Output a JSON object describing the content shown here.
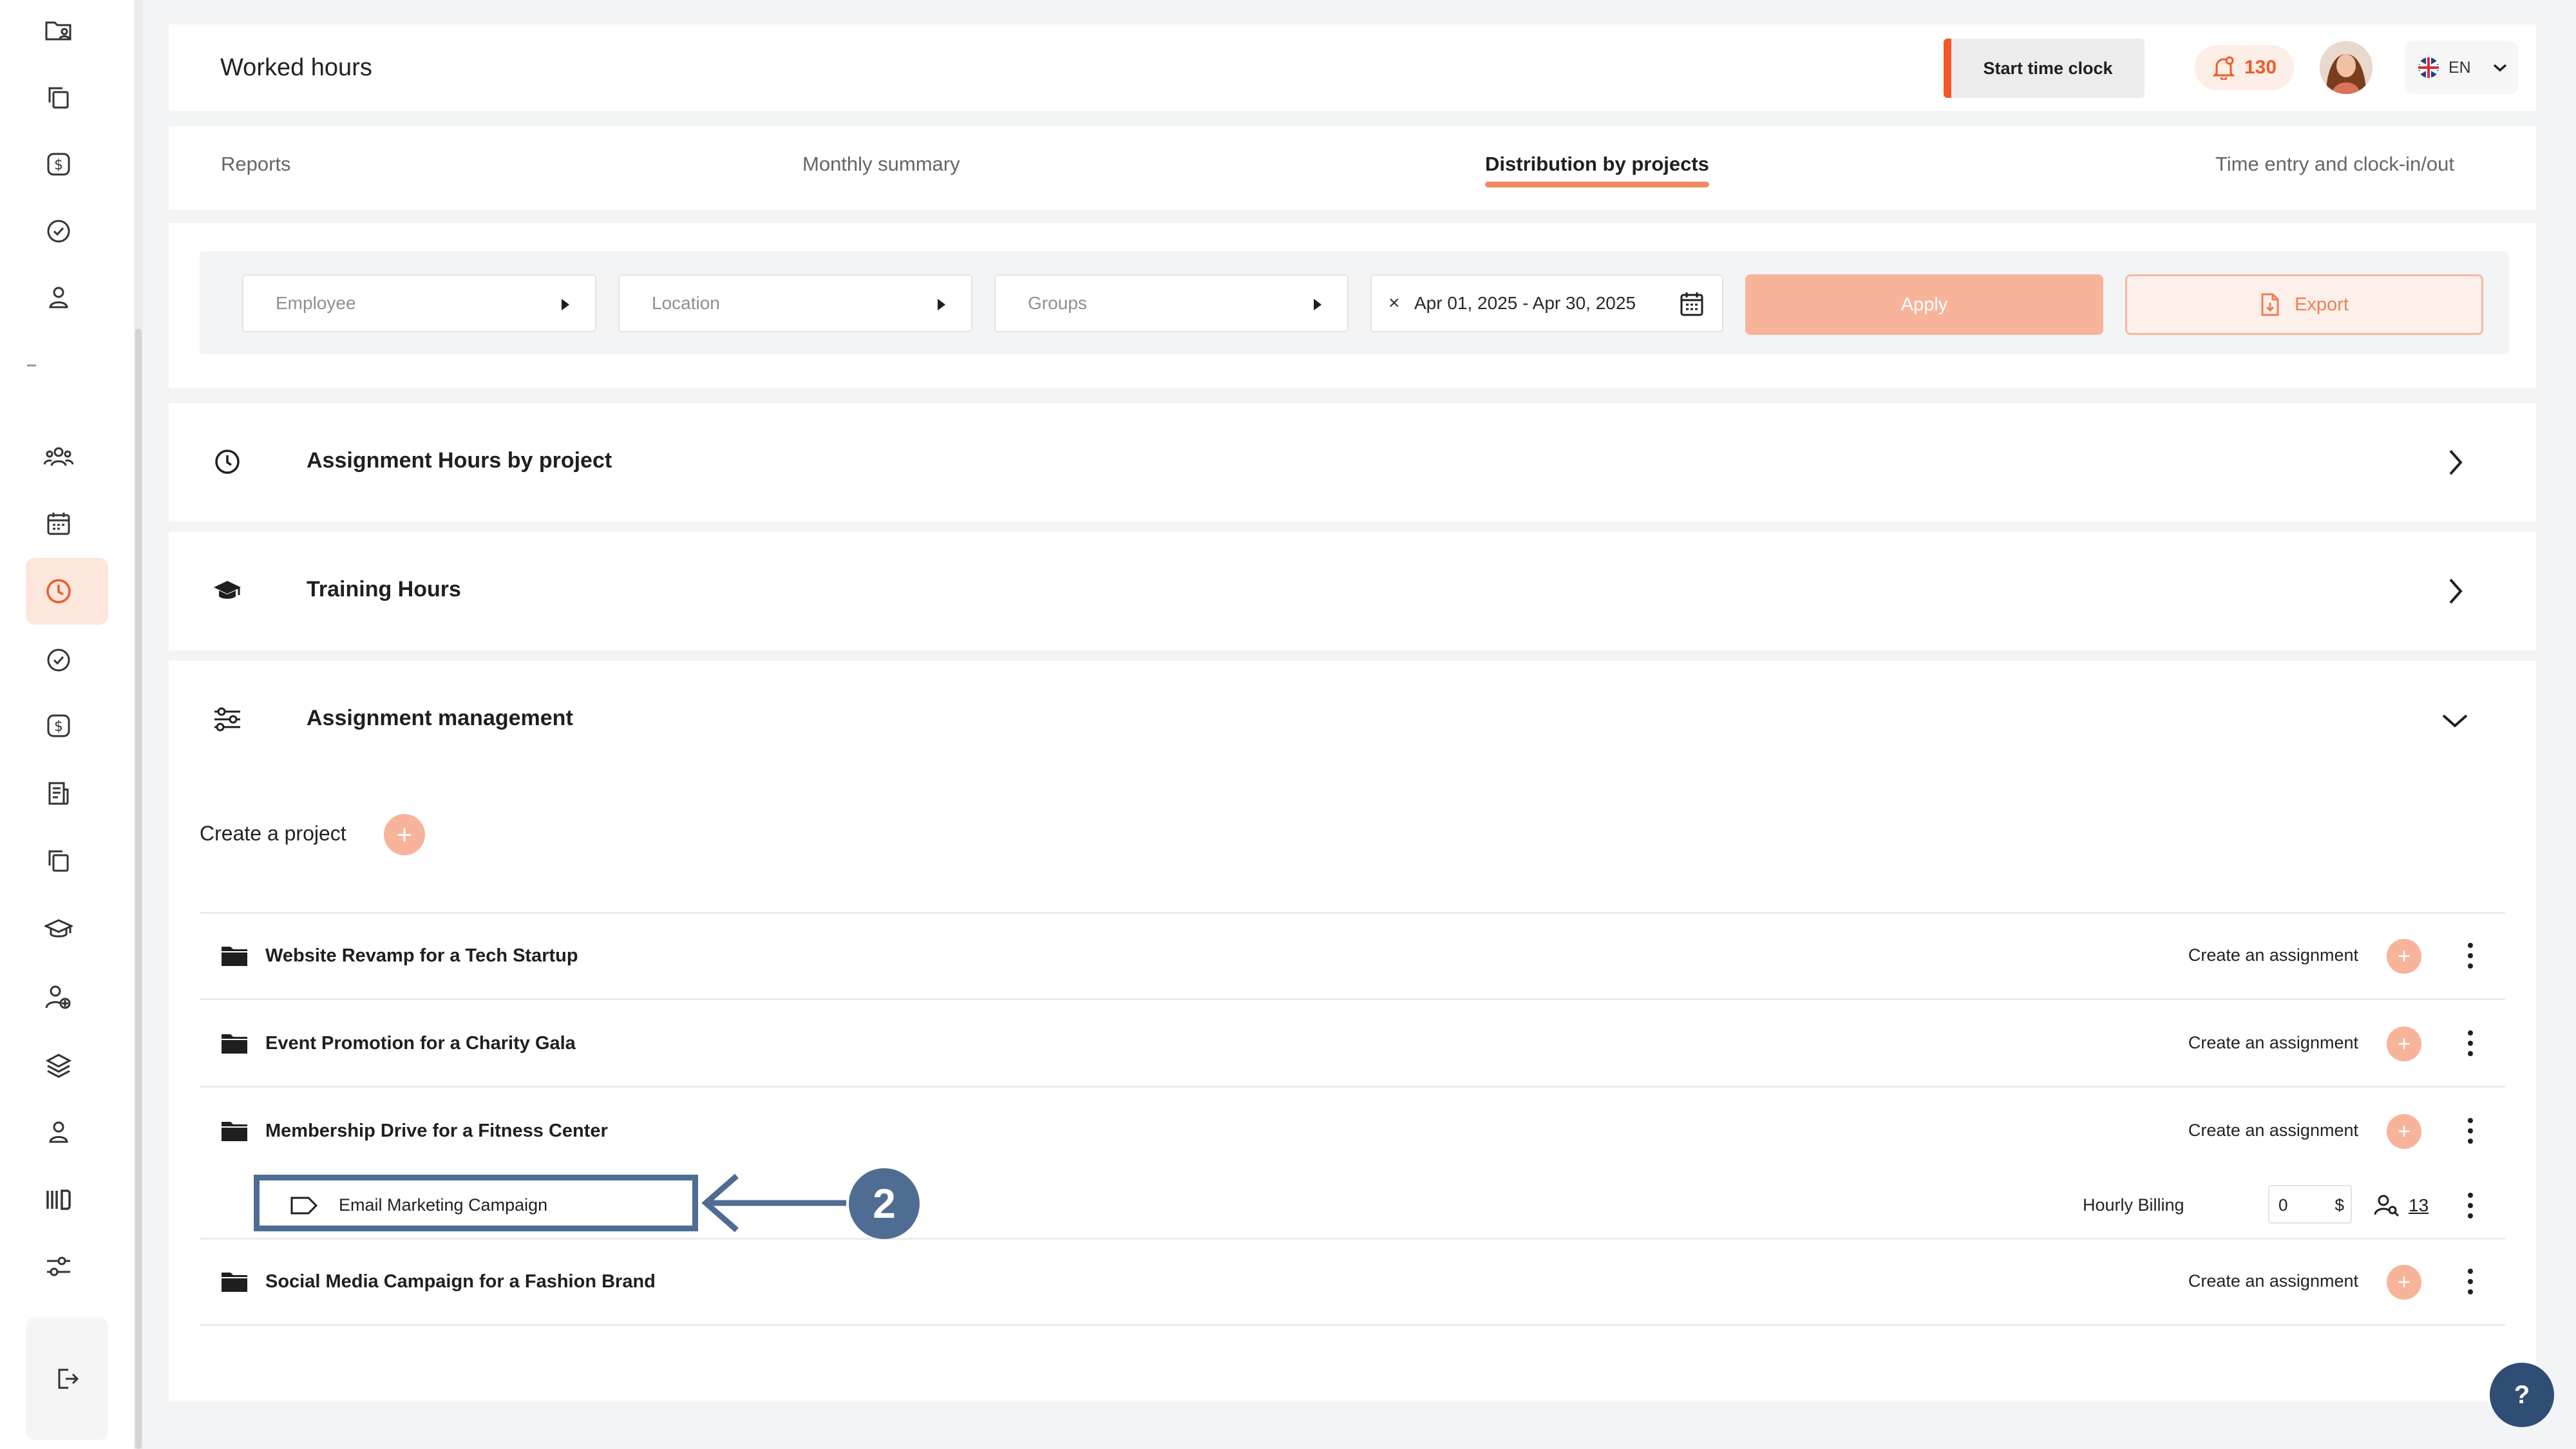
{
  "header": {
    "title": "Worked hours",
    "start_clock_label": "Start time clock",
    "notification_count": "130",
    "language": "EN"
  },
  "tabs": [
    {
      "label": "Reports"
    },
    {
      "label": "Monthly summary"
    },
    {
      "label": "Distribution by projects",
      "active": true
    },
    {
      "label": "Time entry and clock-in/out"
    }
  ],
  "filters": {
    "employee_placeholder": "Employee",
    "location_placeholder": "Location",
    "groups_placeholder": "Groups",
    "date_range": "Apr 01, 2025 - Apr 30, 2025",
    "clear_symbol": "×",
    "apply_label": "Apply",
    "export_label": "Export"
  },
  "sections": {
    "assignment_hours": "Assignment Hours by project",
    "training_hours": "Training Hours",
    "assignment_management": "Assignment management"
  },
  "create_project_label": "Create a project",
  "create_assignment_label": "Create an assignment",
  "projects": [
    {
      "name": "Website Revamp for a Tech Startup"
    },
    {
      "name": "Event Promotion for a Charity Gala"
    },
    {
      "name": "Membership Drive for a Fitness Center"
    },
    {
      "name": "Social Media Campaign for a Fashion Brand"
    }
  ],
  "assignment": {
    "name": "Email Marketing Campaign",
    "billing_label": "Hourly Billing",
    "rate_value": "0",
    "currency": "$",
    "member_count": "13"
  },
  "annotation": {
    "step_number": "2",
    "color": "#4f6d93"
  },
  "help_label": "?",
  "colors": {
    "accent": "#f08a62",
    "accent_light": "#f8b49a",
    "annotation": "#4f6d93",
    "help_button": "#2f4d75"
  }
}
